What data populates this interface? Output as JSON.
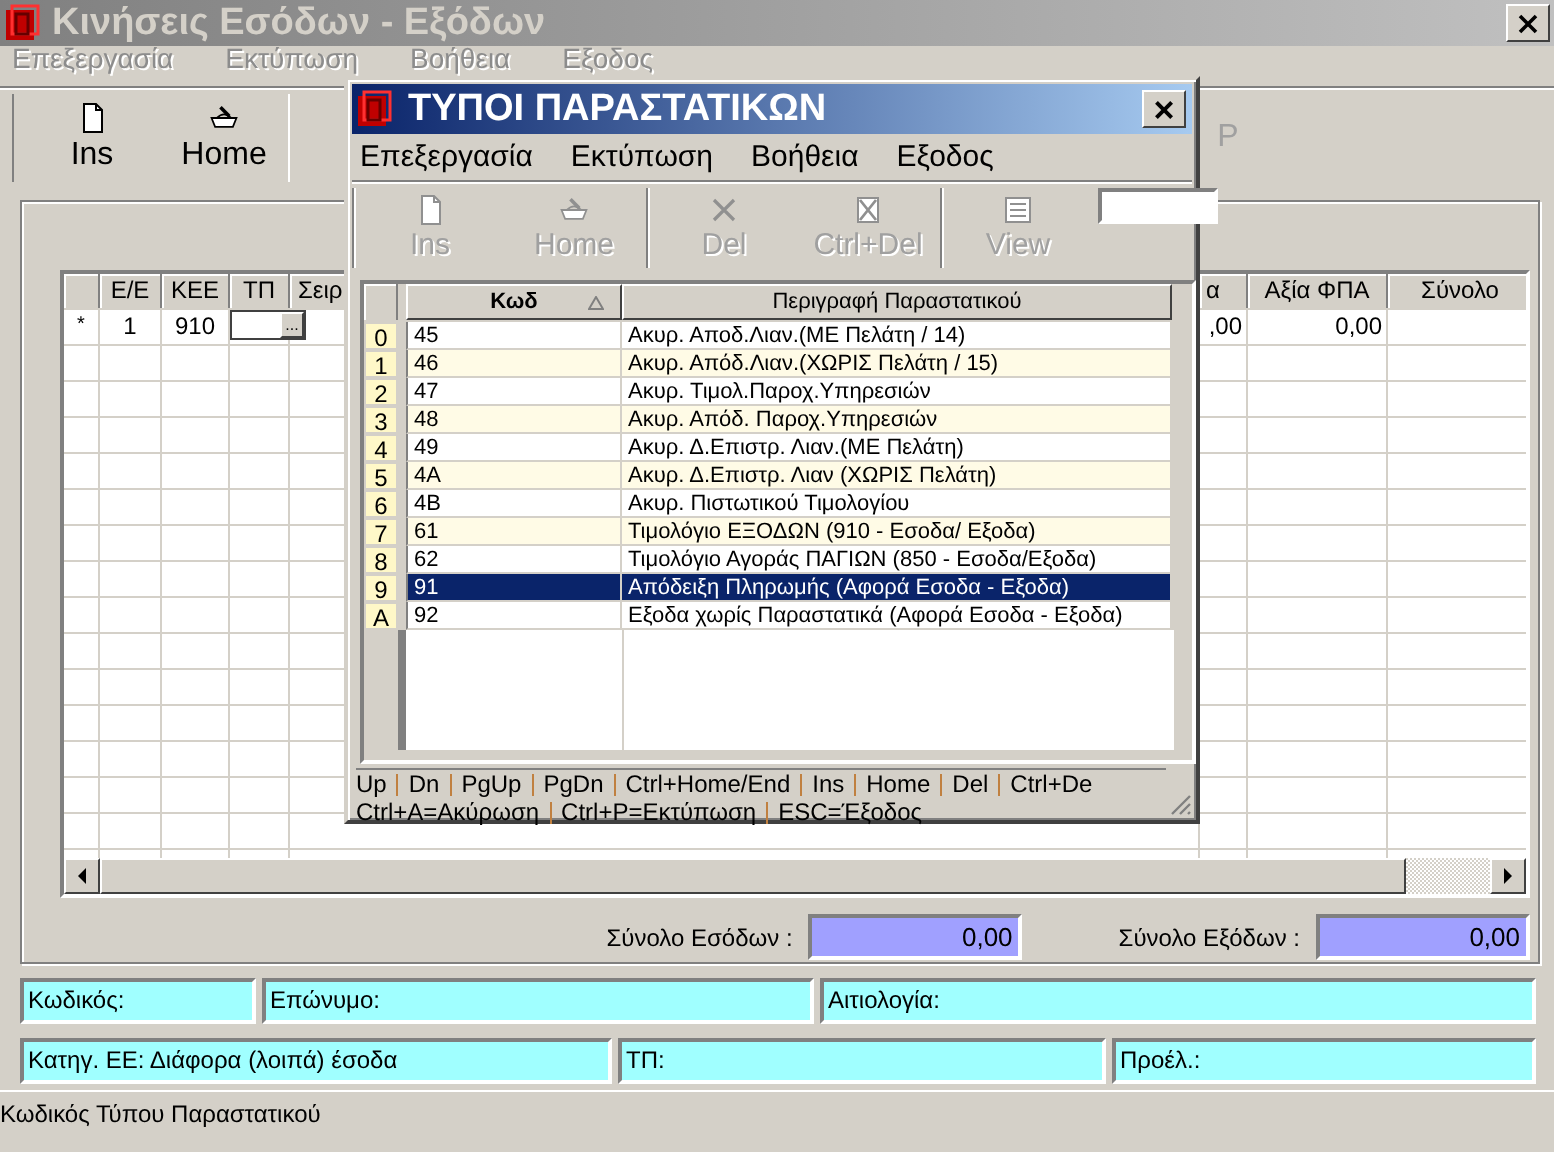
{
  "window": {
    "title": "Κινήσεις Εσόδων - Εξόδων"
  },
  "menu": [
    "Επεξεργασία",
    "Εκτύπωση",
    "Βοήθεια",
    "Εξοδος"
  ],
  "toolbar": [
    [
      {
        "label": "Ins"
      },
      {
        "label": "Home"
      }
    ],
    [
      {
        "label": "P"
      }
    ]
  ],
  "grid": {
    "columns": [
      "Ε/Ε",
      "ΚΕΕ",
      "ΤΠ",
      "Σειρ",
      "α",
      "Αξία ΦΠΑ",
      "Σύνολο"
    ],
    "row": {
      "marker": "*",
      "e_e": "1",
      "kee": "910",
      "tp": {
        "kind": "lookup",
        "button": "..."
      },
      "column_5": ",00",
      "vat_value": "0,00"
    }
  },
  "totals": [
    {
      "label": "Σύνολο Εσόδων :",
      "value": "0,00"
    },
    {
      "label": "Σύνολο Εξόδων :",
      "value": "0,00"
    }
  ],
  "info_rows": [
    [
      "Κωδικός:",
      "Επώνυμο:",
      "Αιτιολογία:"
    ],
    [
      "Κατηγ. ΕΕ: Διάφορα (λοιπά) έσοδα",
      "ΤΠ:",
      "Προέλ.:"
    ]
  ],
  "status_bar": "Κωδικός Τύπου Παραστατικού",
  "dialog": {
    "title": "ΤΥΠΟΙ ΠΑΡΑΣΤΑΤΙΚΩΝ",
    "close": "×",
    "menu": [
      "Επεξεργασία",
      "Εκτύπωση",
      "Βοήθεια",
      "Εξοδος"
    ],
    "toolbar": [
      [
        {
          "label": "Ins"
        },
        {
          "label": "Home"
        }
      ],
      [
        {
          "label": "Del"
        },
        {
          "label": "Ctrl+Del"
        }
      ],
      [
        {
          "label": "View"
        }
      ]
    ],
    "columns": [
      {
        "label": "Κωδ",
        "sorted": true
      },
      {
        "label": "Περιγραφή Παραστατικού"
      }
    ],
    "rows": [
      {
        "index": "0",
        "code": "45",
        "description": "Ακυρ.  Αποδ.Λιαν.(ΜΕ Πελάτη / 14)",
        "selected": false
      },
      {
        "index": "1",
        "code": "46",
        "description": "Ακυρ.  Απόδ.Λιαν.(ΧΩΡΙΣ Πελάτη / 15)",
        "selected": false
      },
      {
        "index": "2",
        "code": "47",
        "description": "Ακυρ.  Τιμολ.Παροχ.Υπηρεσιών",
        "selected": false
      },
      {
        "index": "3",
        "code": "48",
        "description": "Ακυρ.  Απόδ. Παροχ.Υπηρεσιών",
        "selected": false
      },
      {
        "index": "4",
        "code": "49",
        "description": "Ακυρ.  Δ.Επιστρ. Λιαν.(ΜΕ Πελάτη)",
        "selected": false
      },
      {
        "index": "5",
        "code": "4A",
        "description": "Ακυρ.  Δ.Επιστρ. Λιαν (ΧΩΡΙΣ Πελάτη)",
        "selected": false
      },
      {
        "index": "6",
        "code": "4B",
        "description": "Ακυρ.  Πιστωτικού Τιμολογίου",
        "selected": false
      },
      {
        "index": "7",
        "code": "61",
        "description": "Τιμολόγιο ΕΞΟΔΩΝ  (910 - Εσοδα/ Εξοδα)",
        "selected": false
      },
      {
        "index": "8",
        "code": "62",
        "description": "Τιμολόγιο Αγοράς ΠΑΓΙΩΝ  (850 - Εσοδα/Εξοδα)",
        "selected": false
      },
      {
        "index": "9",
        "code": "91",
        "description": "Απόδειξη Πληρωμής  (Αφορά Εσοδα - Εξοδα)",
        "selected": true
      },
      {
        "index": "A",
        "code": "92",
        "description": "Εξοδα χωρίς Παραστατικά  (Αφορά Εσοδα - Εξοδα)",
        "selected": false
      }
    ],
    "footer": [
      [
        "Up",
        "Dn",
        "PgUp",
        "PgDn",
        "Ctrl+Home/End",
        "Ins",
        "Home",
        "Del",
        "Ctrl+De"
      ],
      [
        "Ctrl+A=Ακύρωση",
        "Ctrl+P=Εκτύπωση",
        "ESC=Έξοδος"
      ]
    ]
  }
}
